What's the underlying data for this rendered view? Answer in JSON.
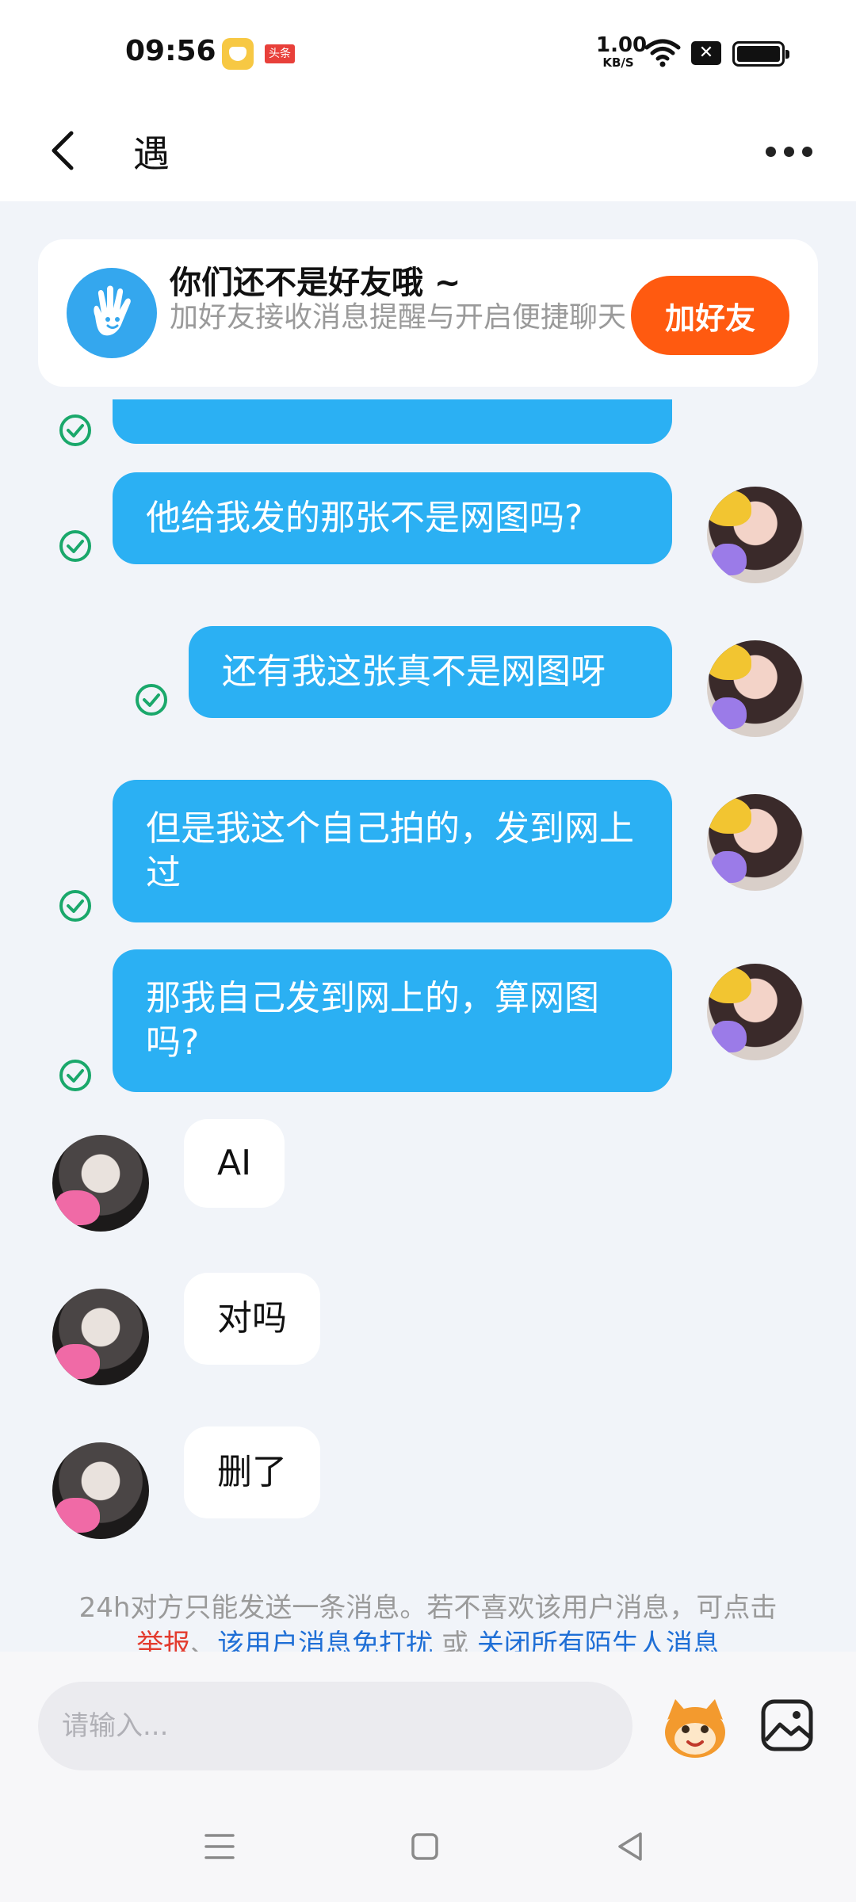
{
  "status_bar": {
    "time": "09:56",
    "app_badge": "头条",
    "net_speed_value": "1.00",
    "net_speed_unit": "KB/S",
    "sim_label": "✕"
  },
  "header": {
    "title": "遇"
  },
  "friend_banner": {
    "title": "你们还不是好友哦 ~",
    "subtitle": "加好友接收消息提醒与开启便捷聊天",
    "button": "加好友"
  },
  "messages": [
    {
      "side": "right",
      "text": "他给我发的那张不是网图吗?"
    },
    {
      "side": "right",
      "text": "还有我这张真不是网图呀"
    },
    {
      "side": "right",
      "text": "但是我这个自己拍的，发到网上过"
    },
    {
      "side": "right",
      "text": "那我自己发到网上的，算网图吗?"
    },
    {
      "side": "left",
      "text": "AI"
    },
    {
      "side": "left",
      "text": "对吗"
    },
    {
      "side": "left",
      "text": "删了"
    }
  ],
  "notice": {
    "text": "24h对方只能发送一条消息。若不喜欢该用户消息，可点击",
    "report": "举报",
    "mid1": "、",
    "block": "该用户消息免打扰",
    "mid2": "或",
    "close_all": "关闭所有陌生人消息"
  },
  "input": {
    "placeholder": "请输入..."
  },
  "colors": {
    "accent_blue": "#2bb0f3",
    "add_friend_orange": "#ff5a10",
    "read_check_green": "#1aa86b"
  }
}
